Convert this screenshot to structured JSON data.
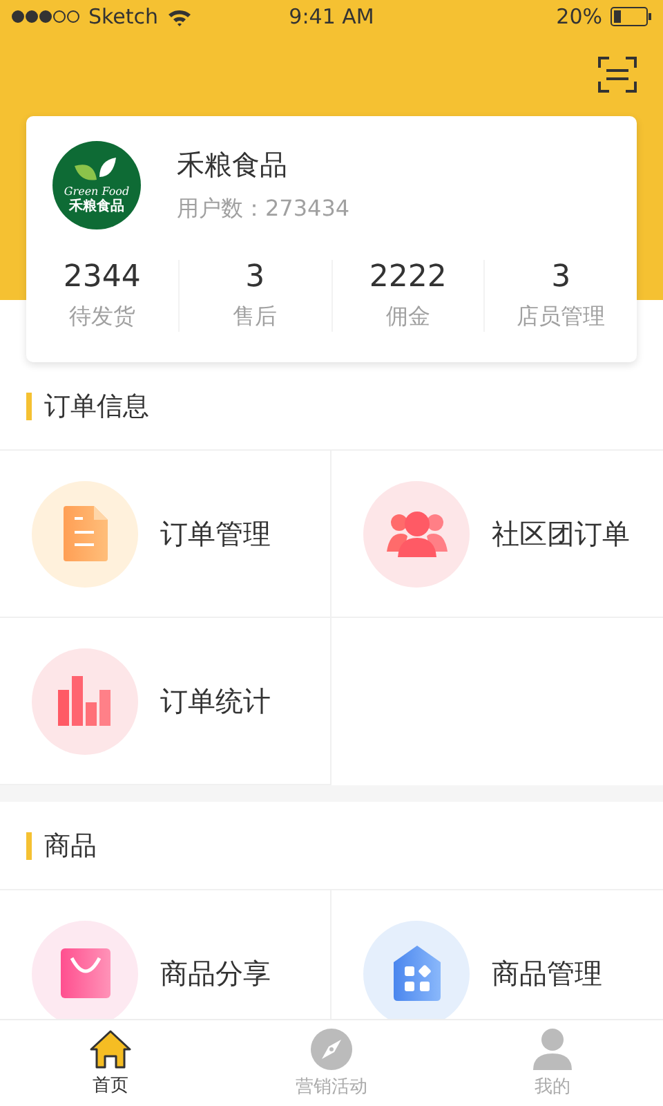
{
  "status_bar": {
    "carrier": "Sketch",
    "time": "9:41 AM",
    "battery": "20%"
  },
  "shop": {
    "logo": {
      "script": "Green Food",
      "name": "禾粮食品"
    },
    "name": "禾粮食品",
    "users": "用户数：273434"
  },
  "stats": [
    {
      "value": "2344",
      "label": "待发货"
    },
    {
      "value": "3",
      "label": "售后"
    },
    {
      "value": "2222",
      "label": "佣金"
    },
    {
      "value": "3",
      "label": "店员管理"
    }
  ],
  "sections": [
    {
      "title": "订单信息",
      "items": [
        {
          "kind": "document",
          "label": "订单管理"
        },
        {
          "kind": "group",
          "label": "社区团订单"
        },
        {
          "kind": "bars",
          "label": "订单统计"
        }
      ]
    },
    {
      "title": "商品",
      "items": [
        {
          "kind": "bag",
          "label": "商品分享"
        },
        {
          "kind": "house",
          "label": "商品管理"
        }
      ]
    }
  ],
  "tab_bar": [
    {
      "kind": "home",
      "label": "首页",
      "selected": true
    },
    {
      "kind": "compass",
      "label": "营销活动",
      "selected": false
    },
    {
      "kind": "person",
      "label": "我的",
      "selected": false
    }
  ]
}
